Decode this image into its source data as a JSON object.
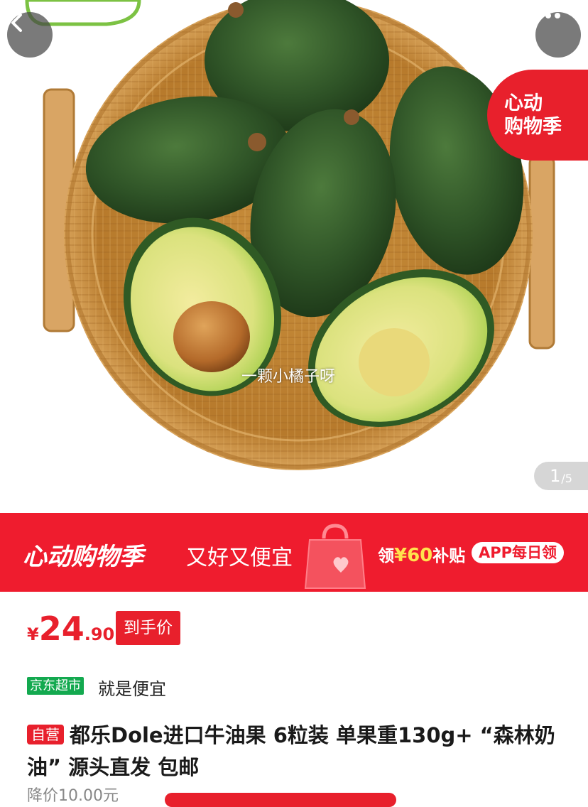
{
  "nav": {
    "back_icon": "chevron-left-icon",
    "more_icon": "ellipsis-icon"
  },
  "gallery": {
    "corner_badge_line1": "心动",
    "corner_badge_line2": "购物季",
    "watermark": "一颗小橘子呀",
    "page_current": "1",
    "page_total": "/5"
  },
  "banner": {
    "main": "心动购物季",
    "sub": "又好又便宜",
    "coupon_prefix": "领",
    "coupon_amount": "¥60",
    "coupon_suffix": "补贴",
    "app_badge": "APP每日领"
  },
  "price": {
    "currency": "¥",
    "integer": "24",
    "decimal": ".90",
    "tag": "到手价"
  },
  "store": {
    "badge": "京东超市",
    "slogan": "就是便宜"
  },
  "product": {
    "tag": "自营",
    "title": "都乐Dole进口牛油果 6粒装 单果重130g+ “森林奶油” 源头直发 包邮"
  },
  "drop_note": "降价10.00元",
  "colors": {
    "accent": "#e8202c",
    "banner": "#ef1c2e",
    "store_green": "#13a94f"
  }
}
